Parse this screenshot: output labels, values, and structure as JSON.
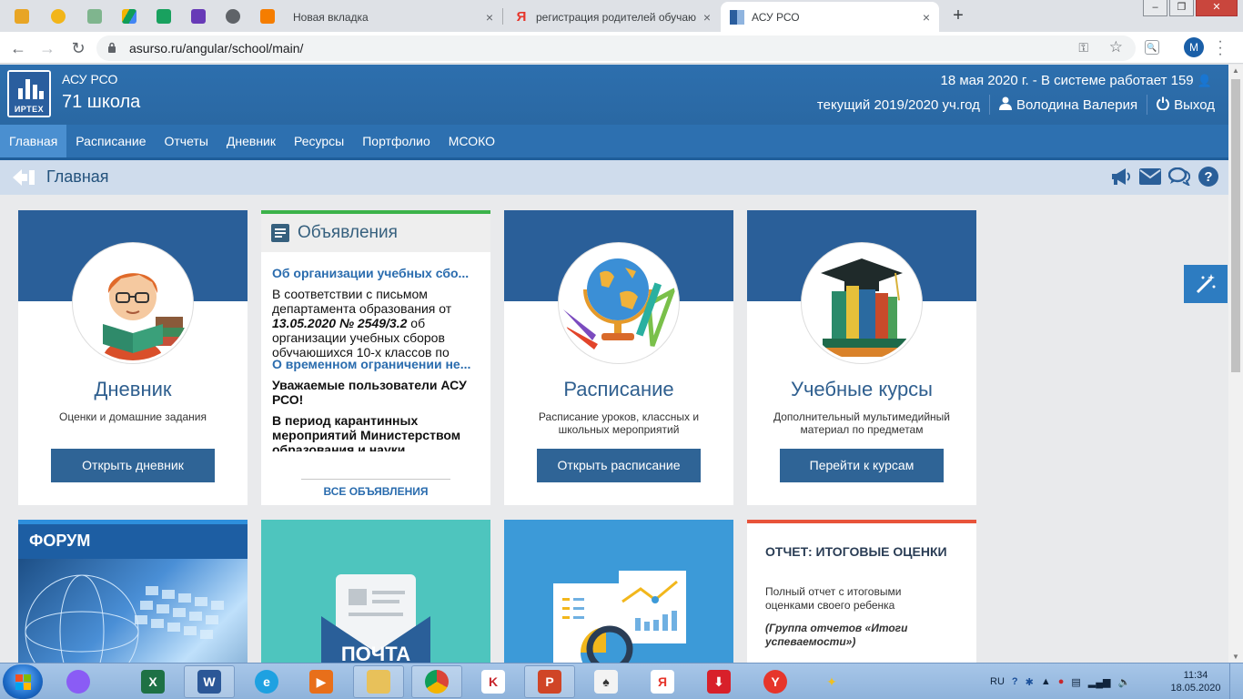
{
  "browser": {
    "tabs": [
      {
        "title": "Новая вкладка",
        "close": "×"
      },
      {
        "title": "регистрация родителей обучаю",
        "close": "×"
      },
      {
        "title": "АСУ РСО",
        "close": "×"
      }
    ],
    "new_tab": "+",
    "url": "asurso.ru/angular/school/main/",
    "profile_initial": "M"
  },
  "header": {
    "app_name": "АСУ РСО",
    "school": "71 школа",
    "logo_text": "ИРТЕХ",
    "system_info": "18 мая 2020 г. - В системе работает 159",
    "year": "текущий 2019/2020 уч.год",
    "user": "Володина Валерия",
    "logout": "Выход"
  },
  "nav": {
    "items": [
      "Главная",
      "Расписание",
      "Отчеты",
      "Дневник",
      "Ресурсы",
      "Портфолио",
      "МСОКО"
    ]
  },
  "breadcrumb": {
    "title": "Главная"
  },
  "cards": {
    "diary": {
      "title": "Дневник",
      "desc": "Оценки и домашние задания",
      "button": "Открыть дневник"
    },
    "schedule": {
      "title": "Расписание",
      "desc": "Расписание уроков, классных и школьных мероприятий",
      "button": "Открыть расписание"
    },
    "courses": {
      "title": "Учебные курсы",
      "desc": "Дополнительный мультимедийный материал по предметам",
      "button": "Перейти к курсам"
    }
  },
  "announcements": {
    "title": "Объявления",
    "item1_link": "Об организации учебных сбо...",
    "item1_text_a": "В соответствии с письмом департамента образования от",
    "item1_text_b": "13.05.2020 № 2549/3.2",
    "item1_text_c": "об организации учебных сборов обучающихся 10-х классов по",
    "item2_link": "О временном ограничении не...",
    "item2_bold1": "Уважаемые пользователи АСУ РСО!",
    "item2_bold2": "В период карантинных мероприятий Министерством образования и науки",
    "all_link": "ВСЕ ОБЪЯВЛЕНИЯ"
  },
  "tiles": {
    "forum": "ФОРУМ",
    "mail": "ПОЧТА",
    "report_title": "ОТЧЕТ: ИТОГОВЫЕ ОЦЕНКИ",
    "report_desc": "Полный отчет с итоговыми оценками своего ребенка",
    "report_note": "(Группа отчетов «Итоги успеваемости»)"
  },
  "taskbar": {
    "lang": "RU",
    "time": "11:34",
    "date": "18.05.2020"
  },
  "colors": {
    "header_blue": "#2d6fae",
    "nav_active": "#4a8fd0",
    "card_band": "#2a5f99",
    "button_blue": "#2f6496",
    "green_accent": "#3cb34a",
    "orange_accent": "#e8533a",
    "teal_tile": "#4ec5be"
  }
}
